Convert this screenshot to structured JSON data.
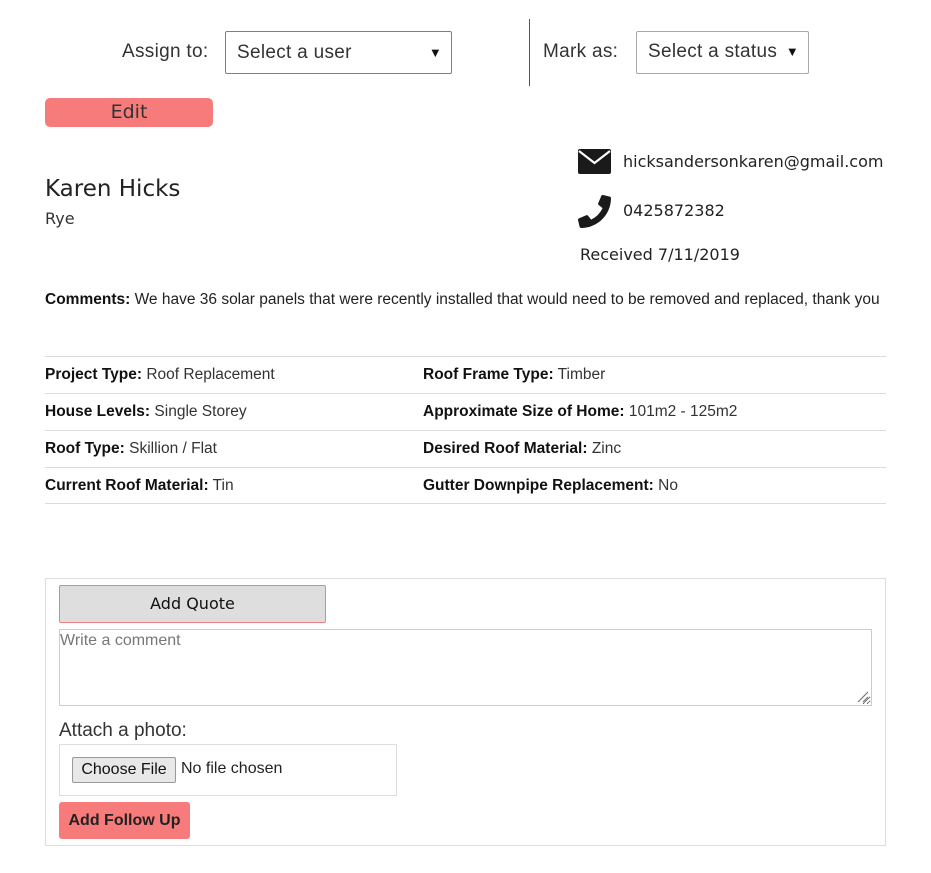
{
  "assign": {
    "label": "Assign to:",
    "selected": "Select a user"
  },
  "status": {
    "label": "Mark as:",
    "selected": "Select a status"
  },
  "edit_label": "Edit",
  "customer": {
    "name": "Karen Hicks",
    "suburb": "Rye",
    "email": "hicksandersonkaren@gmail.com",
    "phone": "0425872382",
    "received": "Received 7/11/2019"
  },
  "comments": {
    "label": "Comments:",
    "text": " We have 36 solar panels that were recently installed that would need to be removed and replaced, thank you"
  },
  "details": [
    [
      {
        "label": "Project Type:",
        "value": " Roof Replacement"
      },
      {
        "label": "Roof Frame Type:",
        "value": " Timber"
      }
    ],
    [
      {
        "label": "House Levels:",
        "value": " Single Storey"
      },
      {
        "label": "Approximate Size of Home:",
        "value": " 101m2 - 125m2"
      }
    ],
    [
      {
        "label": "Roof Type:",
        "value": " Skillion / Flat"
      },
      {
        "label": "Desired Roof Material:",
        "value": " Zinc"
      }
    ],
    [
      {
        "label": "Current Roof Material:",
        "value": " Tin"
      },
      {
        "label": "Gutter Downpipe Replacement:",
        "value": " No"
      }
    ]
  ],
  "followup": {
    "add_quote_label": "Add Quote",
    "comment_placeholder": "Write a comment",
    "attach_label": "Attach a photo:",
    "choose_file_label": "Choose File",
    "no_file_text": "No file chosen",
    "submit_label": "Add Follow Up"
  },
  "icons": {
    "email": "envelope-icon",
    "phone": "phone-icon",
    "caret": "caret-down-icon"
  },
  "colors": {
    "accent": "#f77b7a",
    "select_focus": "#5b87b8",
    "divider": "#dcdcdc"
  }
}
